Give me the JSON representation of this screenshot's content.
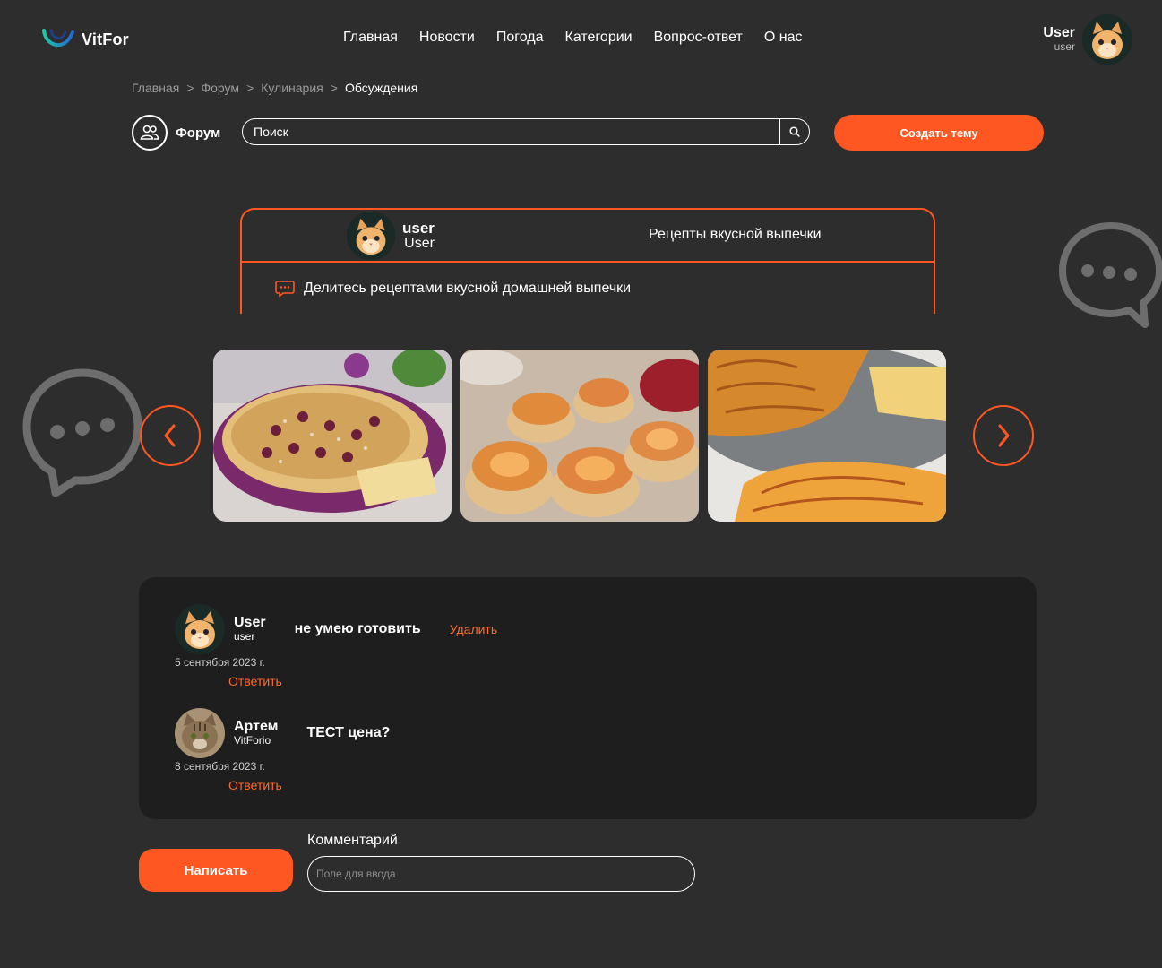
{
  "header": {
    "logo_text": "VitFor",
    "nav": [
      "Главная",
      "Новости",
      "Погода",
      "Категории",
      "Вопрос-ответ",
      "О нас"
    ],
    "user": {
      "name": "User",
      "login": "user"
    }
  },
  "breadcrumb": {
    "items": [
      "Главная",
      "Форум",
      "Кулинария"
    ],
    "current": "Обсуждения",
    "separator": ">"
  },
  "toolbar": {
    "forum_label": "Форум",
    "search_placeholder": "Поиск",
    "create_topic_label": "Создать тему"
  },
  "topic": {
    "author_name": "user",
    "author_role": "User",
    "title": "Рецепты вкусной выпечки",
    "description": "Делитесь рецептами вкусной домашней выпечки"
  },
  "comments": [
    {
      "name": "User",
      "login": "user",
      "text": "не умею готовить",
      "date": "5 сентября 2023 г.",
      "reply_label": "Ответить",
      "delete_label": "Удалить"
    },
    {
      "name": "Артем",
      "login": "VitForio",
      "text": "ТЕСТ цена?",
      "date": "8 сентября 2023 г.",
      "reply_label": "Ответить"
    }
  ],
  "form": {
    "submit_label": "Написать",
    "comment_label": "Комментарий",
    "comment_placeholder": "Поле для ввода"
  },
  "colors": {
    "background": "#2d2d2d",
    "panel": "#1e1e1e",
    "accent": "#ff5722"
  }
}
